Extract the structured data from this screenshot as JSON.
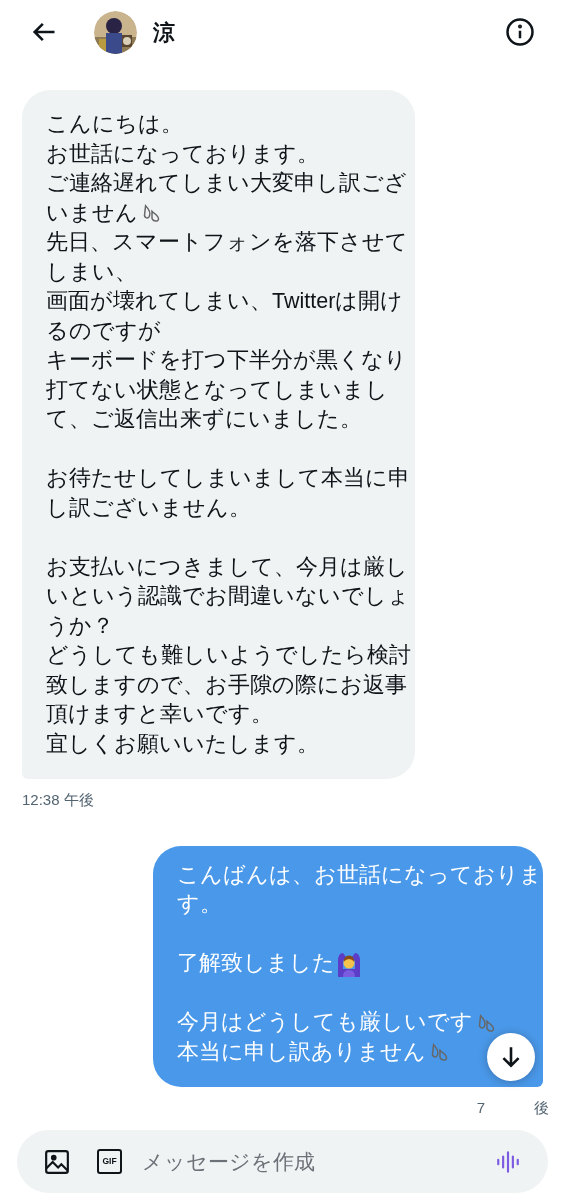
{
  "header": {
    "name": "涼"
  },
  "messages": [
    {
      "kind": "received",
      "paragraphs": [
        [
          {
            "text": "こんにちは。"
          },
          {
            "text": "お世話になっております。"
          },
          {
            "text": "ご連絡遅れてしまい大変申し訳ござ"
          },
          {
            "text": "いません",
            "kind": "sweat"
          },
          {
            "text": "先日、スマートフォンを落下させて"
          },
          {
            "text": "しまい、"
          },
          {
            "text": "画面が壊れてしまい、Twitterは開け"
          },
          {
            "text": "るのですが"
          },
          {
            "text": "キーボードを打つ下半分が黒くなり"
          },
          {
            "text": "打てない状態となってしまいまし"
          },
          {
            "text": "て、ご返信出来ずにいました。"
          }
        ],
        [
          {
            "text": "お待たせしてしまいまして本当に申"
          },
          {
            "text": "し訳ございません。"
          }
        ],
        [
          {
            "text": "お支払いにつきまして、今月は厳し"
          },
          {
            "text": "いという認識でお間違いないでしょ"
          },
          {
            "text": "うか？"
          },
          {
            "text": "どうしても難しいようでしたら検討"
          },
          {
            "text": "致しますので、お手隙の際にお返事"
          },
          {
            "text": "頂けますと幸いです。"
          },
          {
            "text": "宜しくお願いいたします。"
          }
        ]
      ],
      "time_parts": [
        "12:38 午後"
      ]
    },
    {
      "kind": "sent",
      "paragraphs": [
        [
          {
            "text": "こんばんは、お世話になっておりま"
          },
          {
            "text": "す。"
          }
        ],
        [
          {
            "text": "了解致しました",
            "kind": "gesture"
          }
        ],
        [
          {
            "text": "今月はどうしても厳しいです",
            "kind": "sweat"
          },
          {
            "text": "本当に申し訳ありません",
            "kind": "sweat"
          }
        ]
      ],
      "time_parts": [
        "7",
        "後"
      ]
    }
  ],
  "composer": {
    "placeholder": "メッセージを作成",
    "gif_label": "GIF"
  }
}
